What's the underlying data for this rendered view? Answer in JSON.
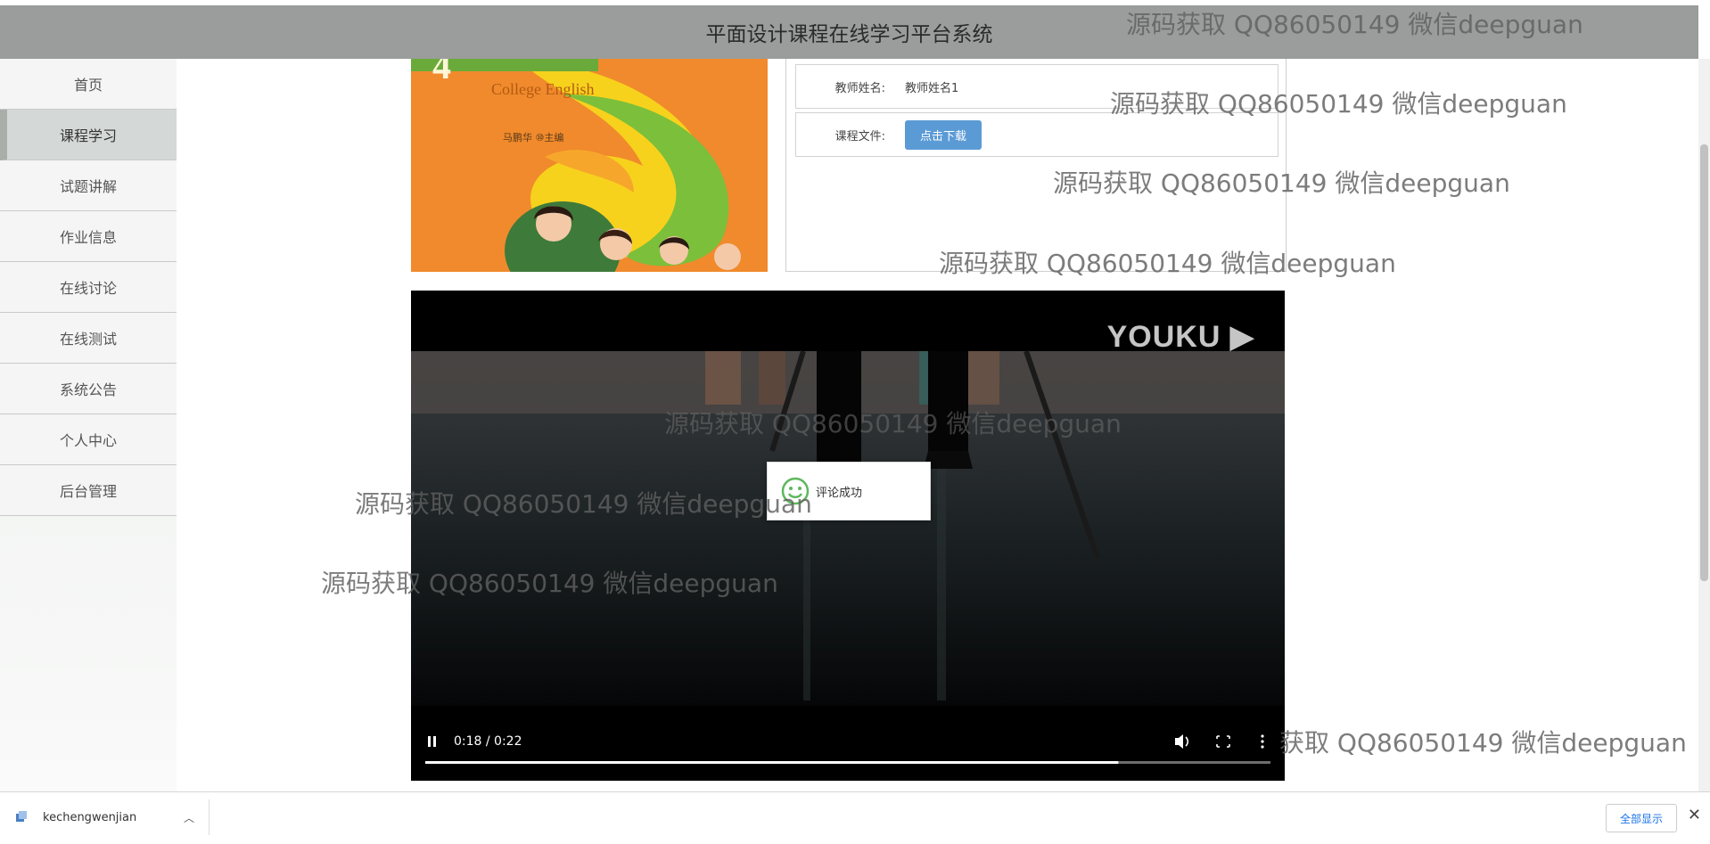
{
  "header": {
    "title": "平面设计课程在线学习平台系统"
  },
  "sidebar": {
    "items": [
      {
        "label": "首页"
      },
      {
        "label": "课程学习"
      },
      {
        "label": "试题讲解"
      },
      {
        "label": "作业信息"
      },
      {
        "label": "在线讨论"
      },
      {
        "label": "在线测试"
      },
      {
        "label": "系统公告"
      },
      {
        "label": "个人中心"
      },
      {
        "label": "后台管理"
      }
    ],
    "active_index": 1
  },
  "course_image": {
    "title_text": "College English",
    "authors_text": "马鹏华  ⑩主编"
  },
  "details": {
    "teacher_label": "教师姓名:",
    "teacher_value": "教师姓名1",
    "file_label": "课程文件:",
    "download_label": "点击下载"
  },
  "video": {
    "logo": "YOUKU",
    "time": "0:18 / 0:22",
    "progress": 0.82,
    "icons": [
      "pause-icon",
      "volume-icon",
      "fullscreen-icon",
      "more-icon"
    ]
  },
  "toast": {
    "message": "评论成功",
    "icon": "smile-icon",
    "color": "#5cb85c"
  },
  "watermark": {
    "text": "源码获取 QQ86050149 微信deepguan"
  },
  "download_bar": {
    "file_name": "kechengwenjian",
    "show_all_label": "全部显示",
    "icons": [
      "file-icon",
      "chevron-up-icon",
      "close-icon"
    ]
  },
  "colors": {
    "header_bg": "#9a9d9b",
    "button_blue": "#5b9bd5",
    "sidebar_active": "#d4d8d6"
  }
}
